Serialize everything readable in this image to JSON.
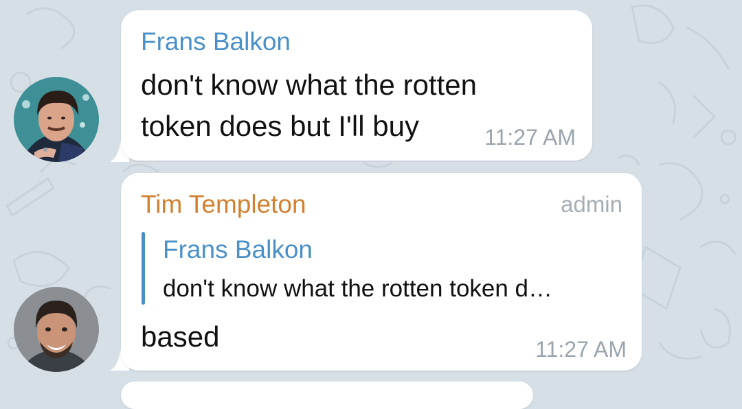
{
  "chat": {
    "messages": [
      {
        "sender": "Frans Balkon",
        "text_lines": [
          "don't know what the rotten",
          "token does but I'll buy"
        ],
        "time": "11:27 AM"
      },
      {
        "sender": "Tim Templeton",
        "badge": "admin",
        "reply": {
          "sender": "Frans Balkon",
          "text": "don't know what the rotten token d…"
        },
        "text": "based",
        "time": "11:27 AM"
      }
    ]
  },
  "colors": {
    "background": "#d7dfe6",
    "bubble": "#ffffff",
    "sender_frans": "#4a90c8",
    "sender_tim": "#d2802f",
    "reply_bar": "#4a90c8",
    "timestamp": "#9aa4ad",
    "admin_badge": "#a5adb5"
  },
  "icons": [
    "avatar-frans-balkon",
    "avatar-tim-templeton"
  ]
}
